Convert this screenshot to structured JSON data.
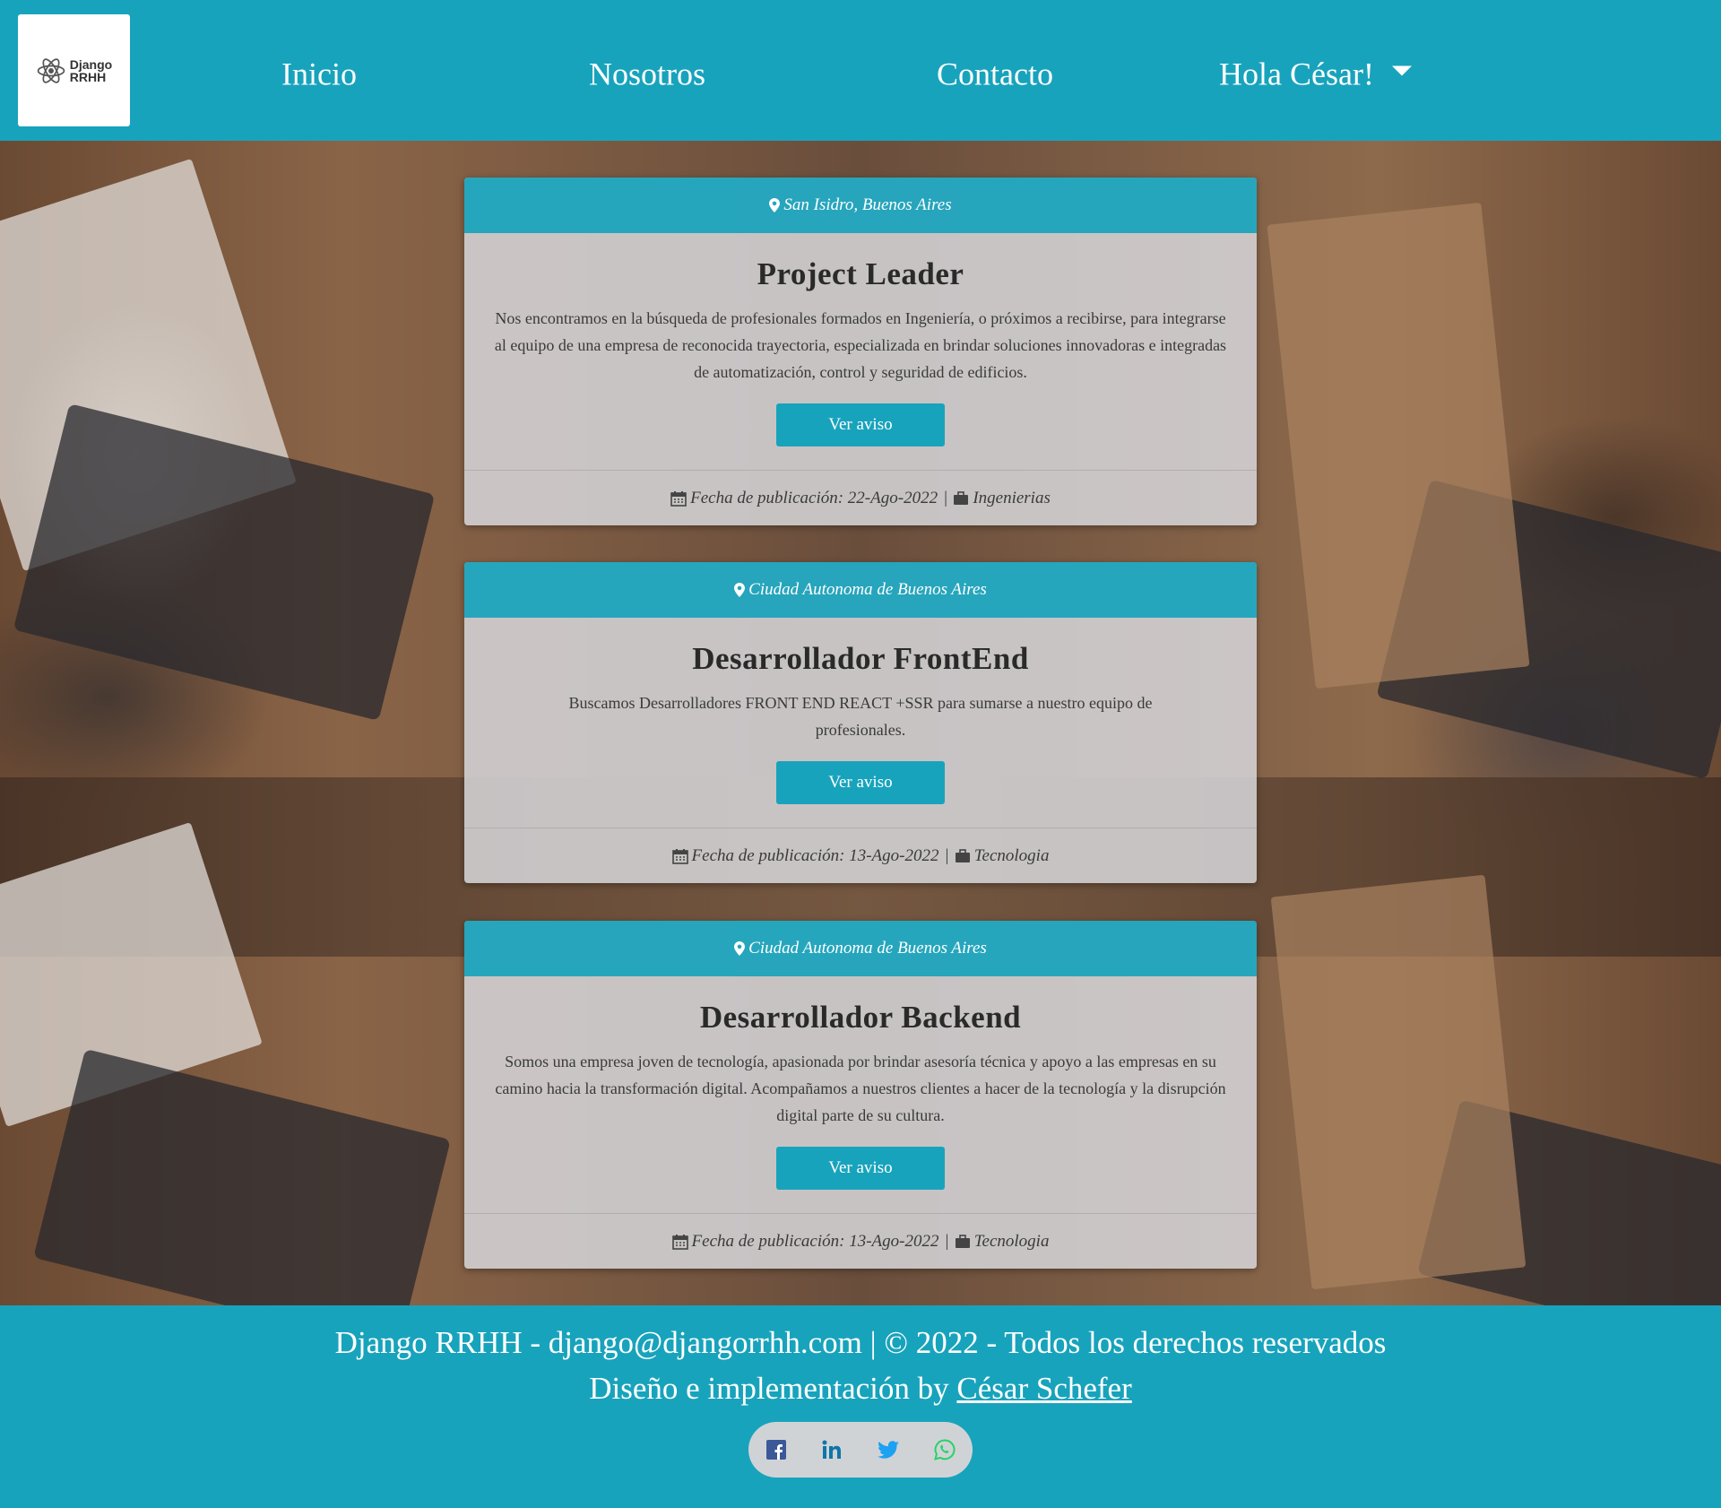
{
  "brand": {
    "logo_line1": "Django",
    "logo_line2": "RRHH"
  },
  "nav": {
    "inicio": "Inicio",
    "nosotros": "Nosotros",
    "contacto": "Contacto",
    "user_greeting": "Hola César!"
  },
  "jobs": [
    {
      "location": "San Isidro, Buenos Aires",
      "title": "Project Leader",
      "description": "Nos encontramos en la búsqueda de profesionales formados en Ingeniería, o próximos a recibirse, para integrarse al equipo de una empresa de reconocida trayectoria, especializada en brindar soluciones innovadoras e integradas de automatización, control y seguridad de edificios.",
      "button": "Ver aviso",
      "date_text": "Fecha de publicación: 22-Ago-2022",
      "separator": "|",
      "category": "Ingenierias"
    },
    {
      "location": "Ciudad Autonoma de Buenos Aires",
      "title": "Desarrollador FrontEnd",
      "description": "Buscamos Desarrolladores FRONT END REACT +SSR para sumarse a nuestro equipo de profesionales.",
      "button": "Ver aviso",
      "date_text": "Fecha de publicación: 13-Ago-2022",
      "separator": "|",
      "category": "Tecnologia"
    },
    {
      "location": "Ciudad Autonoma de Buenos Aires",
      "title": "Desarrollador Backend",
      "description": "Somos una empresa joven de tecnología, apasionada por brindar asesoría técnica y apoyo a las empresas en su camino hacia la transformación digital. Acompañamos a nuestros clientes a hacer de la tecnología y la disrupción digital parte de su cultura.",
      "button": "Ver aviso",
      "date_text": "Fecha de publicación: 13-Ago-2022",
      "separator": "|",
      "category": "Tecnologia"
    }
  ],
  "footer": {
    "line1": "Django RRHH - django@djangorrhh.com | © 2022 - Todos los derechos reservados",
    "line2_prefix": "Diseño e implementación by ",
    "author_link": "César Schefer"
  },
  "social": {
    "icons": [
      "facebook-icon",
      "linkedin-icon",
      "twitter-icon",
      "whatsapp-icon"
    ]
  },
  "colors": {
    "primary": "#18a3bc",
    "card_bg": "#d6d6da",
    "text_dark": "#2a2a2a",
    "facebook": "#3b5998",
    "linkedin": "#0e76a8",
    "twitter": "#1da1f2",
    "whatsapp": "#25d366"
  }
}
